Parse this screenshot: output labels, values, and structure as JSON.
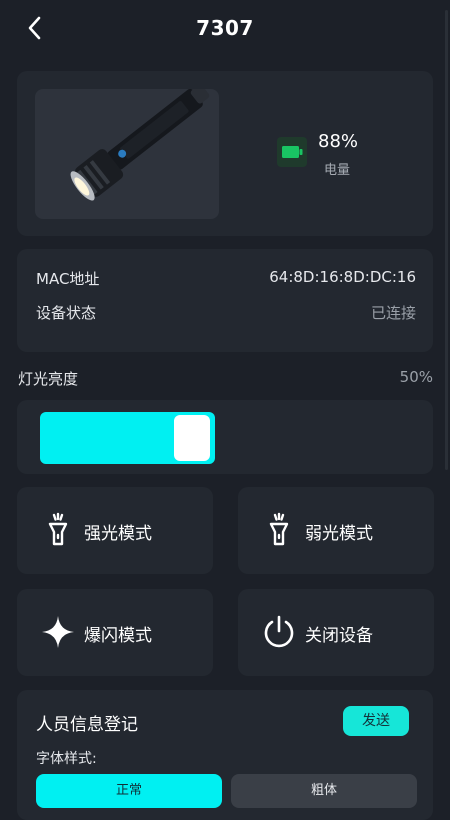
{
  "header": {
    "title": "7307",
    "back_icon": "chevron-left-icon"
  },
  "device": {
    "image": "flashlight-image",
    "battery_icon": "battery-icon",
    "battery_percent": "88%",
    "battery_label": "电量",
    "colors": {
      "battery_icon_fill": "#19c463"
    }
  },
  "info": {
    "rows": [
      {
        "label": "MAC地址",
        "value": "64:8D:16:8D:DC:16"
      },
      {
        "label": "设备状态",
        "value": "已连接"
      }
    ]
  },
  "brightness": {
    "label": "灯光亮度",
    "value_text": "50%",
    "level": 0.5
  },
  "modes": [
    {
      "label": "强光模式",
      "icon": "flashlight-icon"
    },
    {
      "label": "弱光模式",
      "icon": "flashlight-icon"
    },
    {
      "label": "爆闪模式",
      "icon": "sparkle-icon"
    },
    {
      "label": "关闭设备",
      "icon": "power-icon"
    }
  ],
  "registration": {
    "title": "人员信息登记",
    "send_label": "发送",
    "font_style_label": "字体样式:",
    "options": [
      "正常",
      "粗体"
    ],
    "selected": "正常"
  },
  "colors": {
    "accent": "#00f0f2",
    "background": "#1c2028",
    "card": "#232830"
  }
}
